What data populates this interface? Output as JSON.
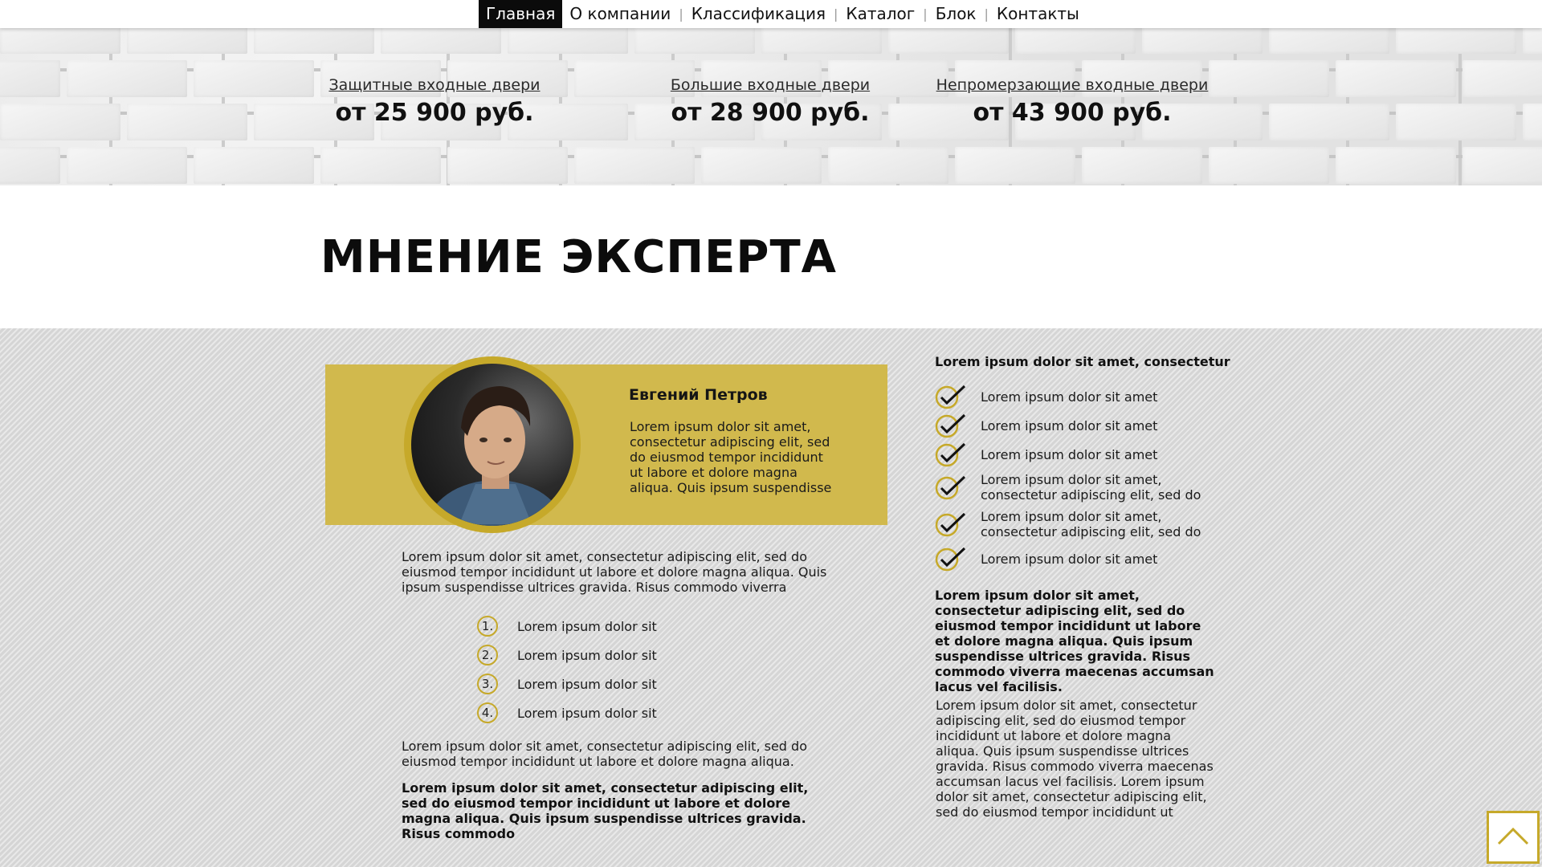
{
  "nav": {
    "items": [
      {
        "label": "Главная",
        "active": true
      },
      {
        "label": "О компании",
        "active": false
      },
      {
        "label": "Классификация",
        "active": false
      },
      {
        "label": "Каталог",
        "active": false
      },
      {
        "label": "Блок",
        "active": false
      },
      {
        "label": "Контакты",
        "active": false
      }
    ],
    "separator": "|"
  },
  "offers": [
    {
      "title": "Защитные входные двери",
      "price": "от 25 900 руб."
    },
    {
      "title": "Большие входные двери",
      "price": "от 28 900 руб."
    },
    {
      "title": "Непромерзающие входные двери",
      "price": "от 43 900 руб."
    }
  ],
  "section_title": "МНЕНИЕ ЭКСПЕРТА",
  "expert": {
    "name": "Евгений Петров",
    "bio": "Lorem ipsum dolor sit amet, consectetur adipiscing elit, sed do eiusmod tempor incididunt ut labore et dolore magna aliqua. Quis ipsum suspendisse"
  },
  "left_column": {
    "intro": "Lorem ipsum dolor sit amet, consectetur adipiscing elit, sed do eiusmod tempor incididunt ut labore et dolore magna aliqua. Quis ipsum suspendisse ultrices gravida. Risus commodo viverra",
    "numbered": [
      {
        "num": "1.",
        "text": "Lorem ipsum dolor sit"
      },
      {
        "num": "2.",
        "text": "Lorem ipsum dolor sit"
      },
      {
        "num": "3.",
        "text": "Lorem ipsum dolor sit"
      },
      {
        "num": "4.",
        "text": "Lorem ipsum dolor sit"
      }
    ],
    "para2": "Lorem ipsum dolor sit amet, consectetur adipiscing elit, sed do eiusmod tempor incididunt ut labore et dolore magna aliqua.",
    "para3_bold": "Lorem ipsum dolor sit amet, consectetur adipiscing elit, sed do eiusmod tempor incididunt ut labore et dolore magna aliqua. Quis ipsum suspendisse ultrices gravida. Risus commodo"
  },
  "right_column": {
    "heading": "Lorem ipsum dolor sit amet, consectetur",
    "checks": [
      "Lorem ipsum dolor sit amet",
      "Lorem ipsum dolor sit amet",
      "Lorem ipsum dolor sit amet",
      "Lorem ipsum dolor sit amet, consectetur adipiscing elit, sed do",
      "Lorem ipsum dolor sit amet, consectetur adipiscing elit, sed do",
      "Lorem ipsum dolor sit amet"
    ],
    "bold_para": "Lorem ipsum dolor sit amet, consectetur adipiscing elit, sed do eiusmod tempor incididunt ut labore et dolore magna aliqua. Quis ipsum suspendisse ultrices gravida. Risus commodo viverra maecenas accumsan lacus vel facilisis.",
    "para": "Lorem ipsum dolor sit amet, consectetur adipiscing elit, sed do eiusmod tempor incididunt ut labore et dolore magna aliqua. Quis ipsum suspendisse ultrices gravida. Risus commodo viverra maecenas accumsan lacus vel facilisis. Lorem ipsum dolor sit amet, consectetur adipiscing elit, sed do eiusmod tempor incididunt ut"
  },
  "colors": {
    "accent": "#c6a92a",
    "card": "#d1b94d",
    "nav_active": "#0b0b0b",
    "band": "#dcdcdc"
  },
  "icons": {
    "check": "check-circle-icon",
    "back_to_top": "chevron-up-icon"
  }
}
